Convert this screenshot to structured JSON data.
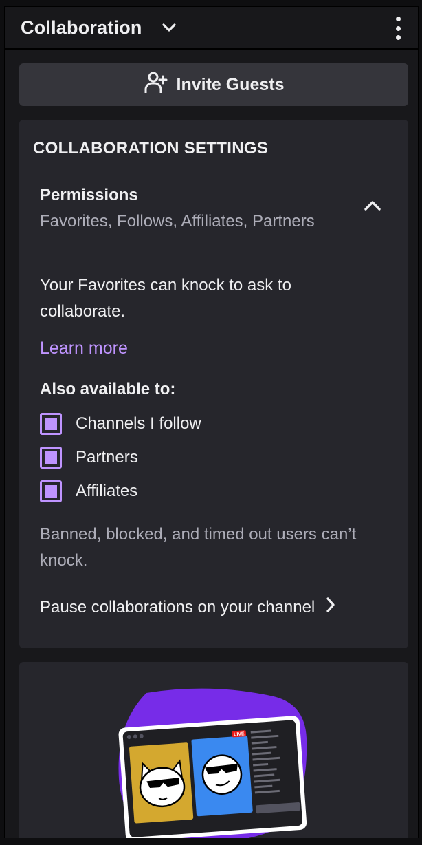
{
  "header": {
    "title": "Collaboration"
  },
  "invite": {
    "label": "Invite Guests"
  },
  "settings": {
    "heading": "COLLABORATION SETTINGS",
    "permissions": {
      "title": "Permissions",
      "value": "Favorites, Follows, Affiliates, Partners"
    },
    "description": "Your Favorites can knock to ask to collaborate.",
    "learn_more": "Learn more",
    "also_available": "Also available to:",
    "options": [
      {
        "label": "Channels I follow",
        "checked": true
      },
      {
        "label": "Partners",
        "checked": true
      },
      {
        "label": "Affiliates",
        "checked": true
      }
    ],
    "note": "Banned, blocked, and timed out users can’t knock.",
    "pause": "Pause collaborations on your channel"
  },
  "promo": {
    "badge": "LIVE"
  },
  "colors": {
    "accent": "#bf94ff",
    "background": "#18181b",
    "card": "#26262c",
    "muted": "#adadb8"
  },
  "icons": [
    "chevron-down-icon",
    "more-vertical-icon",
    "add-user-icon",
    "chevron-up-icon",
    "chevron-right-icon"
  ]
}
